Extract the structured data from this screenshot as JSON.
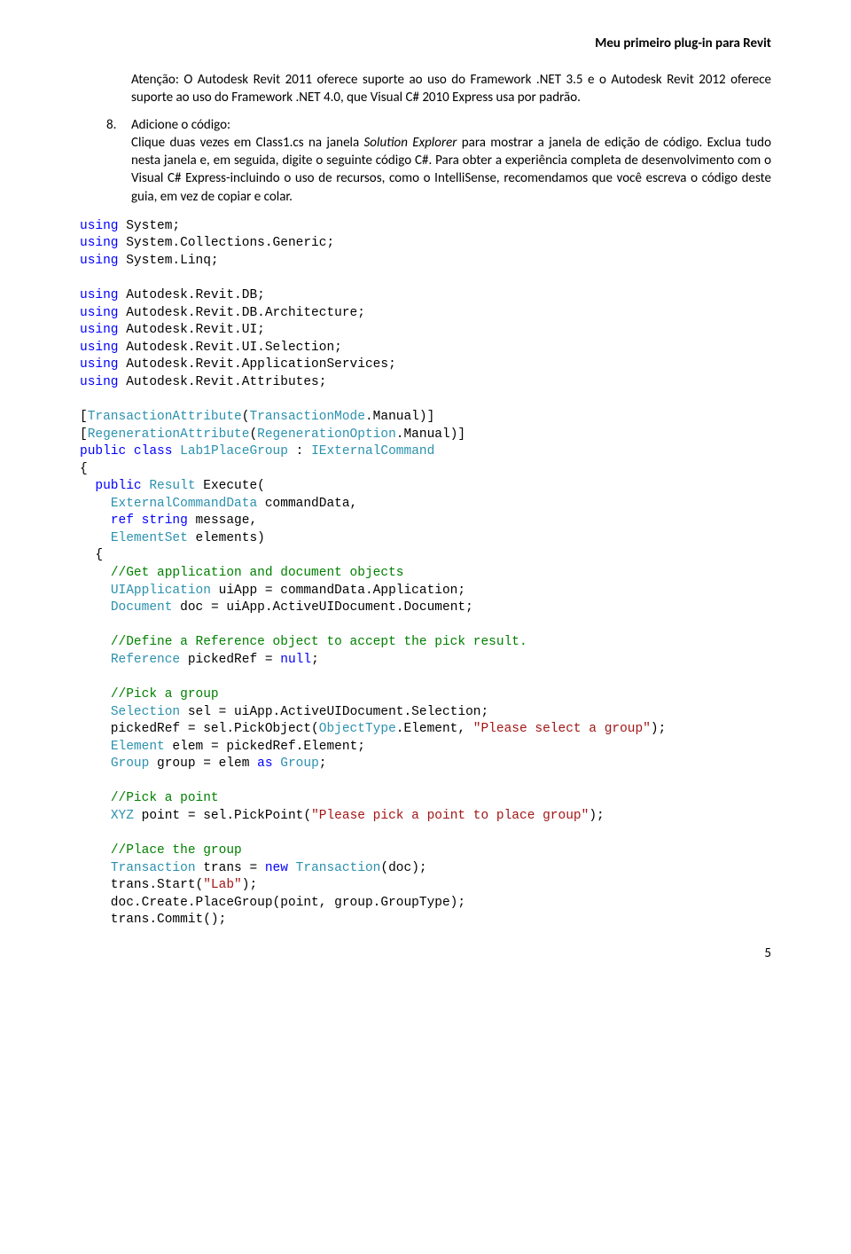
{
  "header": "Meu primeiro plug-in para Revit",
  "para1_before": "Atenção: O Autodesk Revit 2011 oferece suporte ao uso do Framework .NET 3.5 e o Autodesk Revit 2012 oferece suporte ao uso do Framework .NET 4.0, que Visual C# 2010 Express usa por padrão.",
  "item8_num": "8.",
  "item8_line1": "Adicione o código:",
  "item8_line2_a": "Clique duas vezes em Class1.cs na janela ",
  "item8_line2_italic": "Solution Explorer",
  "item8_line2_b": " para mostrar a janela de edição de código. Exclua tudo nesta janela e, em seguida, digite o seguinte código C#. Para obter a experiência completa de desenvolvimento com o Visual C# Express-incluindo o uso de recursos, como o IntelliSense, recomendamos que você escreva o código deste guia, em vez de copiar e colar.",
  "code": {
    "kw_using": "using",
    "ns_system": "System;",
    "ns_generic": "System.Collections.Generic;",
    "ns_linq": "System.Linq;",
    "ns_db": "Autodesk.Revit.DB;",
    "ns_arch": "Autodesk.Revit.DB.Architecture;",
    "ns_ui": "Autodesk.Revit.UI;",
    "ns_sel": "Autodesk.Revit.UI.Selection;",
    "ns_app": "Autodesk.Revit.ApplicationServices;",
    "ns_attr": "Autodesk.Revit.Attributes;",
    "tp_trans_attr": "TransactionAttribute",
    "tp_trans_mode": "TransactionMode",
    "tp_regen_attr": "RegenerationAttribute",
    "tp_regen_opt": "RegenerationOption",
    "kw_public": "public",
    "kw_class": "class",
    "tp_lab1": "Lab1PlaceGroup",
    "tp_iext": "IExternalCommand",
    "tp_result": "Result",
    "id_execute": "Execute(",
    "tp_extcmd": "ExternalCommandData",
    "id_cmddata": " commandData,",
    "kw_ref": "ref",
    "kw_string": "string",
    "id_message": " message,",
    "tp_elemset": "ElementSet",
    "id_elements": " elements)",
    "cm_getapp": "//Get application and document objects",
    "tp_uiapp": "UIApplication",
    "ln_uiapp": " uiApp = commandData.Application;",
    "tp_doc": "Document",
    "ln_doc": " doc = uiApp.ActiveUIDocument.Document;",
    "cm_defref": "//Define a Reference object to accept the pick result.",
    "tp_ref": "Reference",
    "ln_ref": " pickedRef = ",
    "kw_null": "null",
    "cm_pickgrp": "//Pick a group",
    "tp_sel": "Selection",
    "ln_sel": " sel = uiApp.ActiveUIDocument.Selection;",
    "ln_pickobj_a": "    pickedRef = sel.PickObject(",
    "tp_objtype": "ObjectType",
    "ln_pickobj_b": ".Element, ",
    "st_selectgrp": "\"Please select a group\"",
    "tp_elem": "Element",
    "ln_elem": " elem = pickedRef.Element;",
    "tp_group": "Group",
    "ln_group_a": " group = elem ",
    "kw_as": "as",
    "ln_group_b": " ",
    "cm_pickpt": "//Pick a point",
    "tp_xyz": "XYZ",
    "ln_xyz_a": " point = sel.PickPoint(",
    "st_pickpt": "\"Please pick a point to place group\"",
    "cm_place": "//Place the group",
    "tp_transact": "Transaction",
    "ln_trans_a": " trans = ",
    "kw_new": "new",
    "ln_trans_b": " ",
    "ln_trans_c": "(doc);",
    "ln_start_a": "    trans.Start(",
    "st_lab": "\"Lab\"",
    "ln_start_b": ");",
    "ln_placegrp": "    doc.Create.PlaceGroup(point, group.GroupType);",
    "ln_commit": "    trans.Commit();",
    "semi": ";",
    "dot_manual": ".Manual)]",
    "colon_sp": " : ",
    "paren_close": ");"
  },
  "page_num": "5"
}
